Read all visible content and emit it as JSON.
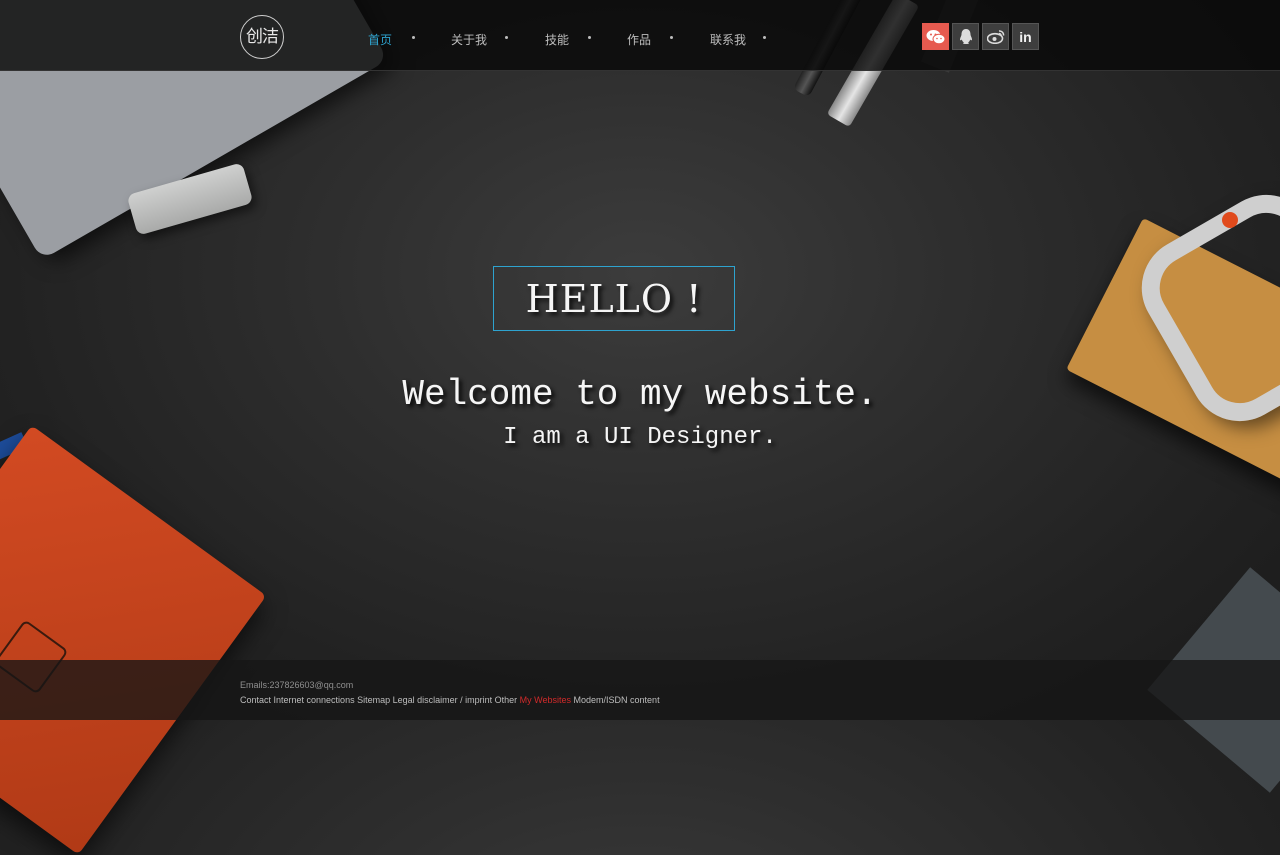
{
  "logo": {
    "text": "创洁"
  },
  "nav": {
    "items": [
      {
        "label": "首页",
        "active": true
      },
      {
        "label": "关于我",
        "active": false
      },
      {
        "label": "技能",
        "active": false
      },
      {
        "label": "作品",
        "active": false
      },
      {
        "label": "联系我",
        "active": false
      }
    ]
  },
  "socials": [
    {
      "name": "wechat-icon",
      "color": "#e65a4f"
    },
    {
      "name": "qq-icon",
      "color": "#3e3e3e"
    },
    {
      "name": "weibo-icon",
      "color": "#3e3e3e"
    },
    {
      "name": "linkedin-icon",
      "label": "in",
      "color": "#3e3e3e"
    }
  ],
  "hero": {
    "hello": "HELLO !",
    "welcome": "Welcome to my website.",
    "subtitle": "I am a UI Designer."
  },
  "footer": {
    "email": "Emails:237826603@qq.com",
    "links_before": "Contact Internet connections Sitemap Legal disclaimer / imprint Other",
    "links_accent": "My Websites",
    "links_after": "Modem/ISDN content"
  },
  "colors": {
    "accent": "#2ea3cf",
    "footer_accent": "#d12a2a",
    "wechat": "#e65a4f"
  }
}
